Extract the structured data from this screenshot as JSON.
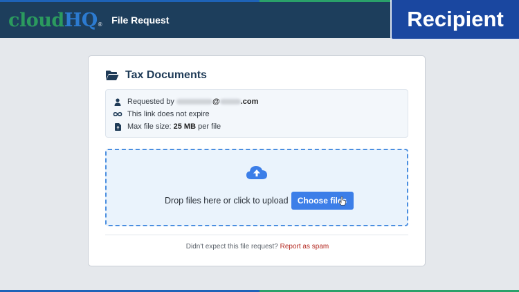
{
  "header": {
    "logo_cloud": "cloud",
    "logo_hq": "HQ",
    "logo_mark": "®",
    "title": "File Request",
    "badge": "Recipient"
  },
  "request": {
    "title": "Tax Documents",
    "title_icon": "folder-open-icon",
    "requested_by_label": "Requested by",
    "requester_email_visible_suffix": ".com",
    "requester_email_at": "@",
    "link_expiry": "This link does not expire",
    "max_size_prefix": "Max file size:",
    "max_size_value": "25 MB",
    "max_size_suffix": "per file"
  },
  "upload": {
    "prompt": "Drop files here or click to upload",
    "button": "Choose files",
    "icon": "cloud-upload-icon"
  },
  "footer": {
    "question": "Didn't expect this file request?",
    "spam_link": "Report as spam"
  },
  "colors": {
    "header_bg": "#1d3e5c",
    "badge_bg": "#1a47a0",
    "accent_blue": "#3c7ee8",
    "accent_green": "#2b9a5e",
    "spam_link": "#b3261e"
  }
}
